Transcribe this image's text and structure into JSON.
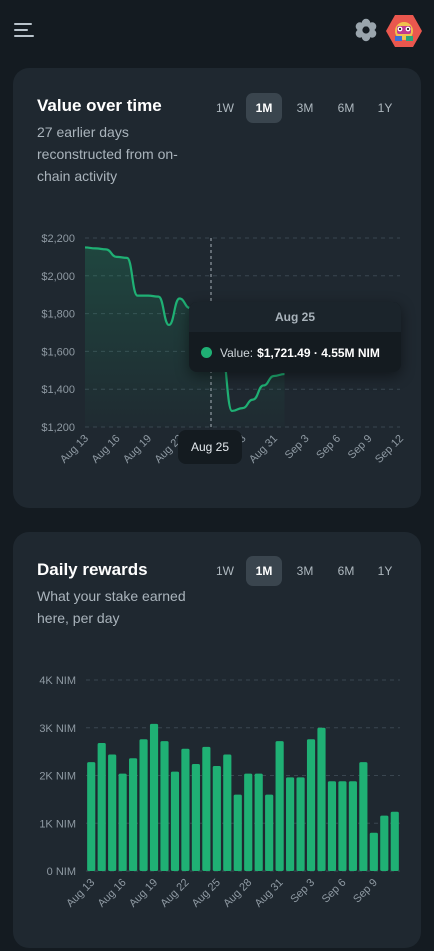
{
  "colors": {
    "background": "#141b21",
    "card": "#1f2830",
    "accent": "#1fb074",
    "tab_active": "#3a454e"
  },
  "header": {
    "menu_icon": "hamburger-menu-icon",
    "settings_icon": "gear-icon",
    "avatar_icon": "identicon-avatar"
  },
  "value_card": {
    "title": "Value over time",
    "subtitle": "27 earlier days reconstructed from on-chain activity",
    "tabs": [
      {
        "label": "1W",
        "active": false
      },
      {
        "label": "1M",
        "active": true
      },
      {
        "label": "3M",
        "active": false
      },
      {
        "label": "6M",
        "active": false
      },
      {
        "label": "1Y",
        "active": false
      }
    ],
    "tooltip": {
      "date": "Aug 25",
      "label": "Value:",
      "value": "$1,721.49 · 4.55M NIM"
    },
    "crosshair_label": "Aug 25"
  },
  "rewards_card": {
    "title": "Daily rewards",
    "subtitle": "What your stake earned here, per day",
    "tabs": [
      {
        "label": "1W",
        "active": false
      },
      {
        "label": "1M",
        "active": true
      },
      {
        "label": "3M",
        "active": false
      },
      {
        "label": "6M",
        "active": false
      },
      {
        "label": "1Y",
        "active": false
      }
    ]
  },
  "chart_data": [
    {
      "type": "area",
      "title": "Value over time",
      "ylim": [
        1200,
        2200
      ],
      "y_ticks": [
        "$2,200",
        "$2,000",
        "$1,800",
        "$1,600",
        "$1,400",
        "$1,200"
      ],
      "x_ticks": [
        "Aug 13",
        "Aug 16",
        "Aug 19",
        "Aug 22",
        "Aug 25",
        "Aug 28",
        "Aug 31",
        "Sep 3",
        "Sep 6",
        "Sep 9",
        "Sep 12"
      ],
      "x_start": "Aug 13",
      "x_end": "Sep 12",
      "series": [
        {
          "points": [
            [
              "Aug 13",
              2150
            ],
            [
              "Aug 14",
              2145
            ],
            [
              "Aug 15",
              2140
            ],
            [
              "Aug 16",
              2100
            ],
            [
              "Aug 17",
              2095
            ],
            [
              "Aug 18",
              1895
            ],
            [
              "Aug 19",
              1895
            ],
            [
              "Aug 20",
              1890
            ],
            [
              "Aug 21",
              1740
            ],
            [
              "Aug 22",
              1880
            ],
            [
              "Aug 23",
              1830
            ],
            [
              "Aug 24",
              1760
            ],
            [
              "Aug 25",
              1721
            ],
            [
              "Aug 26",
              1600
            ],
            [
              "Aug 27",
              1285
            ],
            [
              "Aug 28",
              1300
            ],
            [
              "Aug 29",
              1345
            ],
            [
              "Aug 30",
              1420
            ],
            [
              "Aug 31",
              1470
            ],
            [
              "Sep 1",
              1480
            ]
          ]
        }
      ],
      "highlight": {
        "x": "Aug 25",
        "value": 1721.49
      },
      "grid": true,
      "legend": "none"
    },
    {
      "type": "bar",
      "title": "Daily rewards",
      "ylim": [
        0,
        4000
      ],
      "y_ticks": [
        "4K NIM",
        "3K NIM",
        "2K NIM",
        "1K NIM",
        "0 NIM"
      ],
      "x_ticks": [
        "Aug 13",
        "Aug 16",
        "Aug 19",
        "Aug 22",
        "Aug 25",
        "Aug 28",
        "Aug 31",
        "Sep 3",
        "Sep 6",
        "Sep 9"
      ],
      "tick_every": 3,
      "values": [
        2280,
        2680,
        2440,
        2040,
        2360,
        2760,
        3080,
        2720,
        2080,
        2560,
        2240,
        2600,
        2200,
        2440,
        1600,
        2040,
        2040,
        1600,
        2720,
        1960,
        1960,
        2760,
        3000,
        1880,
        1880,
        1880,
        2280,
        800,
        1160,
        1240
      ],
      "grid": true,
      "legend": "none"
    }
  ]
}
